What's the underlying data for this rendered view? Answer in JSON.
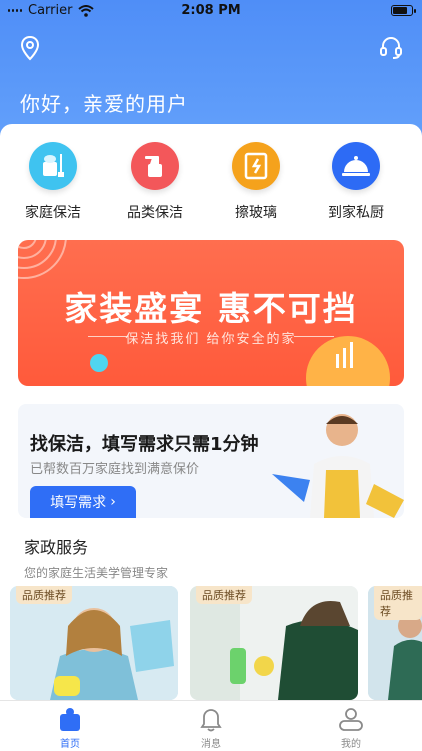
{
  "status_bar": {
    "carrier": "Carrier",
    "time": "2:08 PM",
    "battery_level": 0.85
  },
  "header": {
    "greeting": "你好，亲爱的用户",
    "location_icon": "location-icon",
    "service_icon": "headset-icon"
  },
  "categories": [
    {
      "label": "家庭保洁",
      "icon": "cleaning-bucket-icon",
      "color": "#3fc3f0"
    },
    {
      "label": "品类保洁",
      "icon": "spray-bottle-icon",
      "color": "#f3575a"
    },
    {
      "label": "擦玻璃",
      "icon": "window-icon",
      "color": "#f5a21c"
    },
    {
      "label": "到家私厨",
      "icon": "cloche-icon",
      "color": "#2d6bf5"
    }
  ],
  "banner": {
    "title": "家装盛宴 惠不可挡",
    "subtitle": "保洁找我们 给你安全的家"
  },
  "promo": {
    "title": "找保洁，填写需求只需1分钟",
    "subtitle": "已帮数百万家庭找到满意保价",
    "button_label": "填写需求"
  },
  "section": {
    "title": "家政服务",
    "subtitle": "您的家庭生活美学管理专家",
    "cards": [
      {
        "badge": "品质推荐"
      },
      {
        "badge": "品质推荐"
      },
      {
        "badge": "品质推荐"
      }
    ]
  },
  "tabbar": {
    "items": [
      {
        "label": "首页",
        "icon": "home-icon",
        "active": true
      },
      {
        "label": "消息",
        "icon": "bell-icon",
        "active": false
      },
      {
        "label": "我的",
        "icon": "profile-icon",
        "active": false
      }
    ]
  },
  "colors": {
    "primary": "#2f6ef6",
    "header_gradient_top": "#4f8ef7",
    "banner": "#ff5a3b"
  }
}
